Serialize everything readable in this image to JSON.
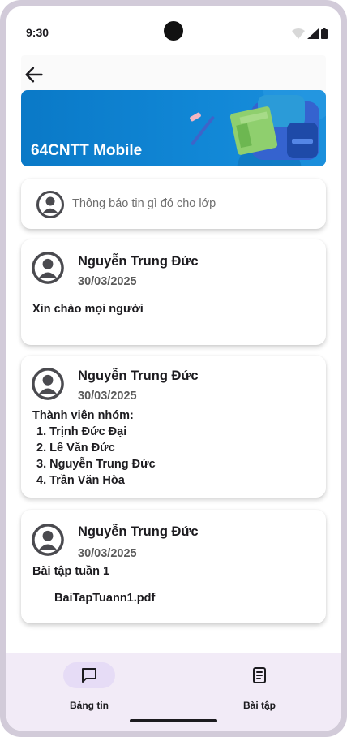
{
  "status_bar": {
    "time": "9:30"
  },
  "banner": {
    "title": "64CNTT Mobile"
  },
  "composer": {
    "placeholder": "Thông báo tin gì đó cho lớp"
  },
  "posts": [
    {
      "author": "Nguyễn Trung Đức",
      "date": "30/03/2025",
      "text": "Xin chào mọi người"
    },
    {
      "author": "Nguyễn Trung Đức",
      "date": "30/03/2025",
      "text": "Thành viên nhóm:",
      "list": [
        "1. Trịnh Đức Đại",
        "2. Lê Văn Đức",
        "3. Nguyễn Trung Đức",
        "4. Trần Văn Hòa"
      ]
    },
    {
      "author": "Nguyễn Trung Đức",
      "date": "30/03/2025",
      "text": "Bài tập tuần 1",
      "attachment": "BaiTapTuann1.pdf"
    }
  ],
  "bottom_nav": {
    "items": [
      {
        "label": "Bảng tin",
        "icon": "message-square-icon",
        "active": true
      },
      {
        "label": "Bài tập",
        "icon": "document-icon",
        "active": false
      }
    ]
  },
  "colors": {
    "banner": "#0a79c7",
    "nav_background": "#f2ebf7",
    "active_pill": "#e6dcf6"
  }
}
